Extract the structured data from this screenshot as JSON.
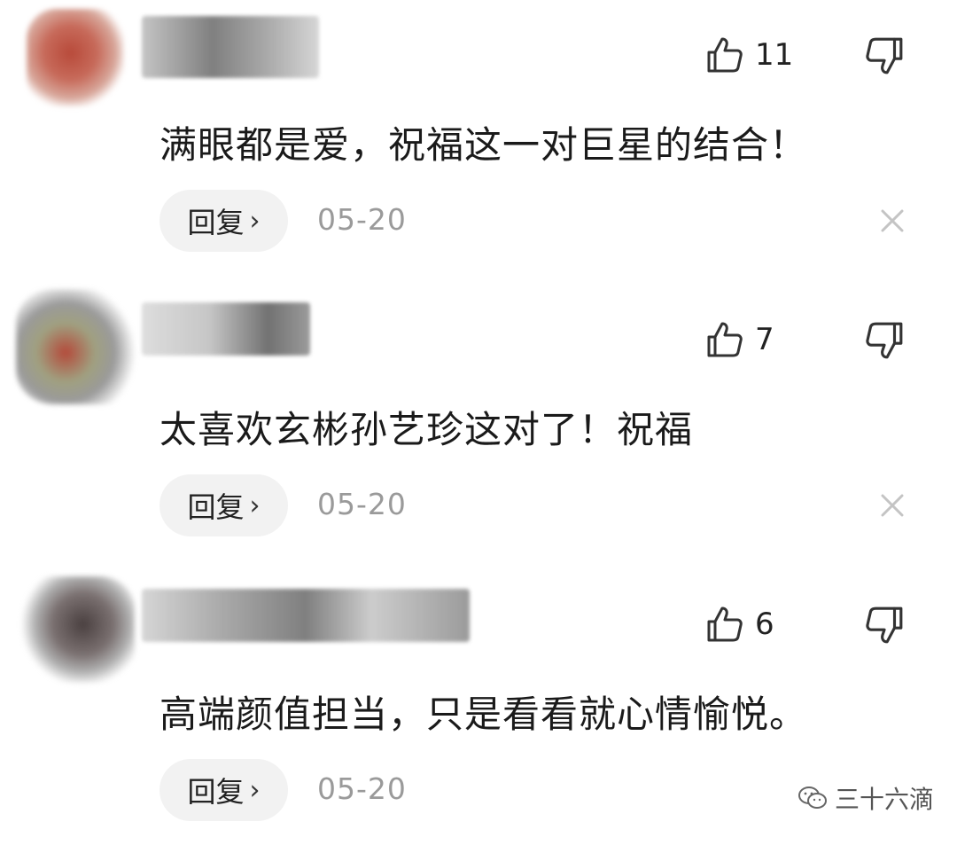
{
  "comments": [
    {
      "text": "满眼都是爱，祝福这一对巨星的结合！",
      "likes": "11",
      "reply_label": "回复",
      "date": "05-20"
    },
    {
      "text": "太喜欢玄彬孙艺珍这对了！祝福",
      "likes": "7",
      "reply_label": "回复",
      "date": "05-20"
    },
    {
      "text": "高端颜值担当，只是看看就心情愉悦。",
      "likes": "6",
      "reply_label": "回复",
      "date": "05-20"
    }
  ],
  "watermark": {
    "text": "三十六滴"
  },
  "icons": {
    "like": "thumbs-up-icon",
    "dislike": "thumbs-down-icon",
    "chevron": "chevron-right-icon",
    "close": "close-icon",
    "wechat": "wechat-icon"
  },
  "colors": {
    "reply_bg": "#f2f2f2",
    "date_text": "#9a9a9a",
    "icon_stroke": "#333333"
  }
}
